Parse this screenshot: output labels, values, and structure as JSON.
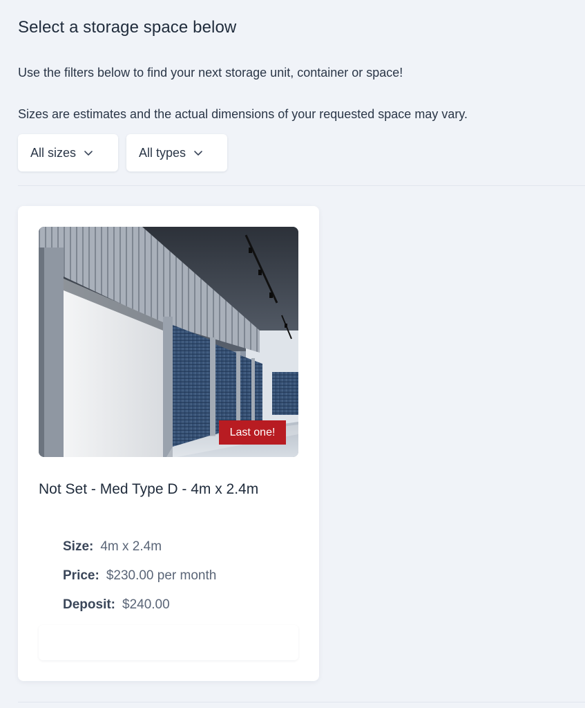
{
  "header": {
    "title": "Select a storage space below",
    "intro": "Use the filters below to find your next storage unit, container or space!",
    "disclaimer": "Sizes are estimates and the actual dimensions of your requested space may vary."
  },
  "filters": {
    "size": {
      "label": "All sizes",
      "icon": "chevron-down-icon"
    },
    "type": {
      "label": "All types",
      "icon": "chevron-down-icon"
    }
  },
  "units": [
    {
      "badge": "Last one!",
      "title": "Not Set - Med Type D - 4m x 2.4m",
      "size_label": "Size:",
      "size_value": "4m x 2.4m",
      "price_label": "Price:",
      "price_value": "$230.00 per month",
      "deposit_label": "Deposit:",
      "deposit_value": "$240.00"
    }
  ],
  "colors": {
    "page_background": "#f0f3f8",
    "card_background": "#ffffff",
    "badge_background": "#b81c22",
    "text_primary": "#1f2b3b",
    "text_secondary": "#5a6577",
    "roller_door_blue": "#3b5678"
  }
}
